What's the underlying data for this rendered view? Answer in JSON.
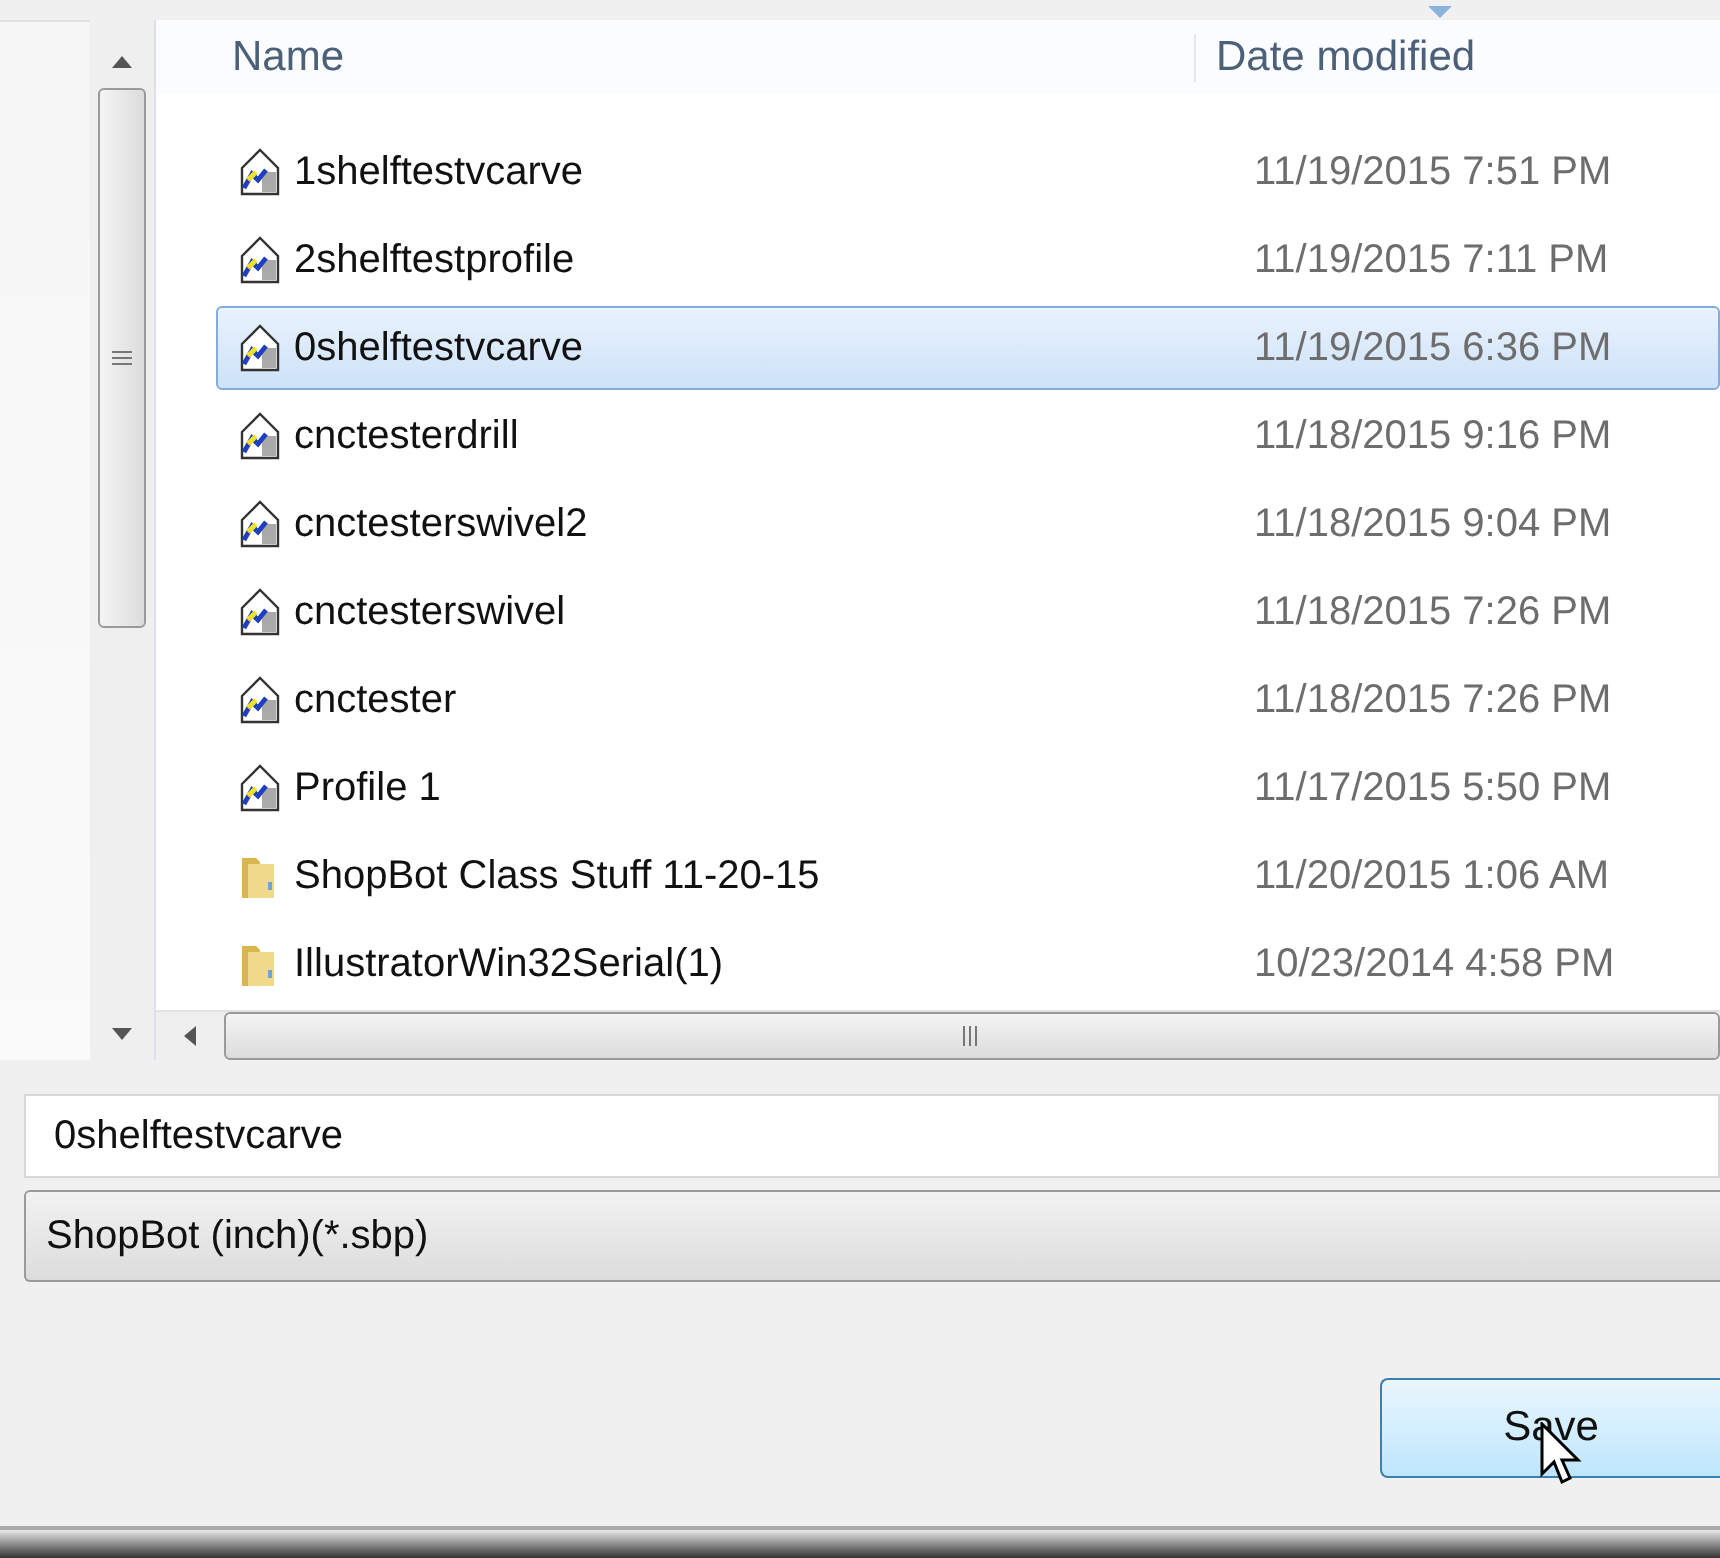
{
  "columns": [
    "Name",
    "Date modified"
  ],
  "files": [
    {
      "kind": "file",
      "name": "1shelftestvcarve",
      "date": "11/19/2015 7:51 PM",
      "selected": false
    },
    {
      "kind": "file",
      "name": "2shelftestprofile",
      "date": "11/19/2015 7:11 PM",
      "selected": false
    },
    {
      "kind": "file",
      "name": "0shelftestvcarve",
      "date": "11/19/2015 6:36 PM",
      "selected": true
    },
    {
      "kind": "file",
      "name": "cnctesterdrill",
      "date": "11/18/2015 9:16 PM",
      "selected": false
    },
    {
      "kind": "file",
      "name": "cnctesterswivel2",
      "date": "11/18/2015 9:04 PM",
      "selected": false
    },
    {
      "kind": "file",
      "name": "cnctesterswivel",
      "date": "11/18/2015 7:26 PM",
      "selected": false
    },
    {
      "kind": "file",
      "name": "cnctester",
      "date": "11/18/2015 7:26 PM",
      "selected": false
    },
    {
      "kind": "file",
      "name": "Profile 1",
      "date": "11/17/2015 5:50 PM",
      "selected": false
    },
    {
      "kind": "folder",
      "name": "ShopBot Class Stuff 11-20-15",
      "date": "11/20/2015 1:06 AM",
      "selected": false
    },
    {
      "kind": "folder",
      "name": "IllustratorWin32Serial(1)",
      "date": "10/23/2014 4:58 PM",
      "selected": false
    }
  ],
  "filename": {
    "value": "0shelftestvcarve"
  },
  "file_type": {
    "value": "ShopBot (inch)(*.sbp)"
  },
  "buttons": [
    "Save"
  ]
}
